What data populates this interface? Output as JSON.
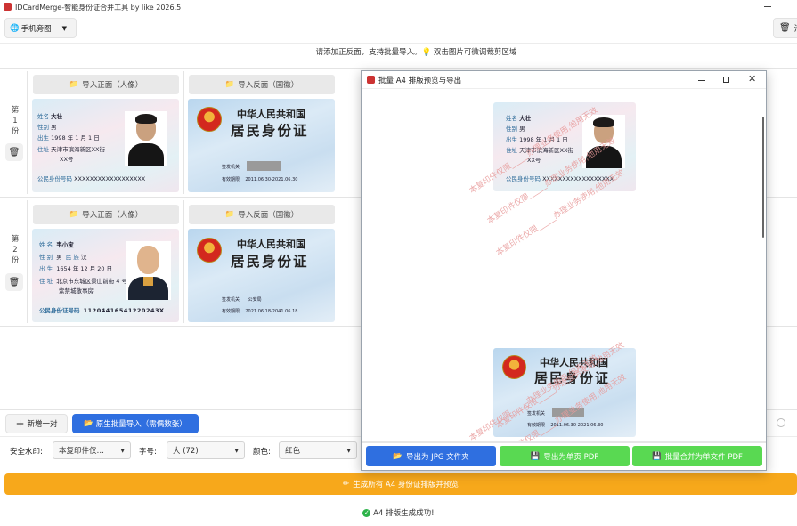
{
  "window": {
    "title": "IDCardMerge-智能身份证合并工具 by like 2026.5"
  },
  "toolbar": {
    "mode_label": "手机旁图",
    "clear_label": "清"
  },
  "hint_text": "请添加正反面，支持批量导入。💡 双击图片可微调裁剪区域",
  "rows": [
    {
      "label_top": "第",
      "label_num": "1",
      "label_bot": "份",
      "front_btn": "导入正面（人像）",
      "back_btn": "导入反面（国徽）",
      "front": {
        "name_label": "姓名",
        "name": "大壮",
        "sex_label": "性别",
        "sex": "男",
        "birth_label": "出生",
        "birth": "1998 年 1 月 1 日",
        "addr_label": "住址",
        "addr1": "天津市滨海新区XX街",
        "addr2": "XX号",
        "id_label": "公民身份号码",
        "id": "XXXXXXXXXXXXXXXXXX"
      },
      "back": {
        "title1": "中华人民共和国",
        "title2": "居民身份证",
        "auth_label": "签发机关",
        "valid_label": "有效期限",
        "valid": "2011.06.30-2021.06.30"
      }
    },
    {
      "label_top": "第",
      "label_num": "2",
      "label_bot": "份",
      "front_btn": "导入正面（人像）",
      "back_btn": "导入反面（国徽）",
      "front": {
        "name_label": "姓 名",
        "name": "韦小宝",
        "sex_label": "性 别",
        "sex": "男",
        "nation_label": "民 族",
        "nation": "汉",
        "birth_label": "出 生",
        "birth": "1654 年 12 月 20 日",
        "addr_label": "住 址",
        "addr1": "北京市东城区景山前街 4 号",
        "addr2": "紫禁城敬事房",
        "id_label": "公民身份证号码",
        "id": "11204416541220243X"
      },
      "back": {
        "title1": "中华人民共和国",
        "title2": "居民身份证",
        "auth_label": "签发机关",
        "auth": "公安局",
        "valid_label": "有效期限",
        "valid": "2021.06.18-2041.06.18"
      }
    }
  ],
  "actions": {
    "add_pair": "新增一对",
    "batch_import": "原生批量导入（需偶数张）"
  },
  "settings": {
    "watermark_label": "安全水印:",
    "watermark_value": "本复印件仅…",
    "fontsize_label": "字号:",
    "fontsize_value": "大 (72)",
    "color_label": "颜色:",
    "color_value": "红色"
  },
  "generate_label": "生成所有 A4 身份证排版并预览",
  "status_text": "A4 排版生成成功!",
  "modal": {
    "title": "批量 A4 排版预览与导出",
    "watermark_text": "本复印件仅限_____办理业务使用,他用无效",
    "btn_jpg": "导出为 JPG 文件夹",
    "btn_pdf_single": "导出为单页 PDF",
    "btn_pdf_merge": "批量合并为单文件 PDF"
  },
  "colors": {
    "primary": "#2f6fe0",
    "green": "#59d952",
    "orange": "#f7a81b",
    "accent_red": "#d3281e"
  }
}
